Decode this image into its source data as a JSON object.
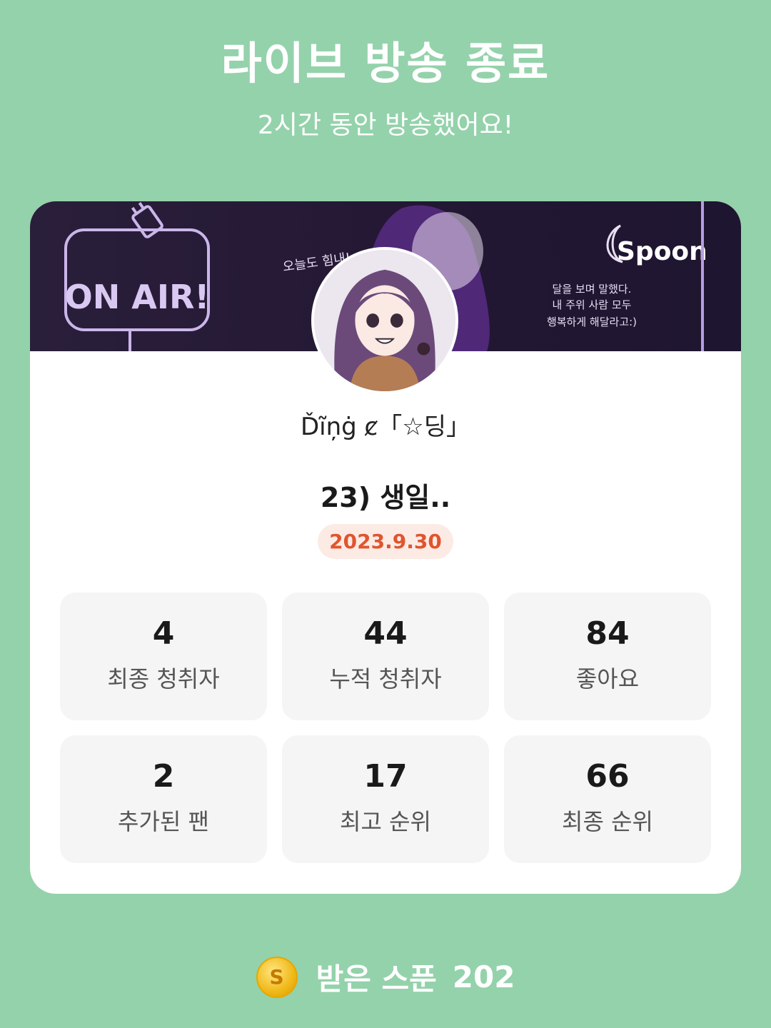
{
  "header": {
    "title": "라이브 방송 종료",
    "subtitle": "2시간 동안 방송했어요!"
  },
  "banner": {
    "sign_text": "ON AIR!",
    "doodle_text": "오늘도 힘내!",
    "brand": "Spoon",
    "quote_lines": [
      "달을 보며 말했다.",
      "내 주위 사람 모두",
      "행복하게 해달라고:)"
    ]
  },
  "profile": {
    "username": "Ďĩņġ ȼ「☆딩」"
  },
  "live": {
    "title": "23) 생일..",
    "date": "2023.9.30"
  },
  "stats": [
    {
      "value": "4",
      "label": "최종 청취자"
    },
    {
      "value": "44",
      "label": "누적 청취자"
    },
    {
      "value": "84",
      "label": "좋아요"
    },
    {
      "value": "2",
      "label": "추가된 팬"
    },
    {
      "value": "17",
      "label": "최고 순위"
    },
    {
      "value": "66",
      "label": "최종 순위"
    }
  ],
  "footer": {
    "coin_symbol": "S",
    "label": "받은 스푼",
    "amount": "202"
  },
  "colors": {
    "background": "#94d2ab",
    "date_text": "#e0552f",
    "date_bg": "#fcebe5",
    "banner_bg": "#2a1a3e"
  }
}
